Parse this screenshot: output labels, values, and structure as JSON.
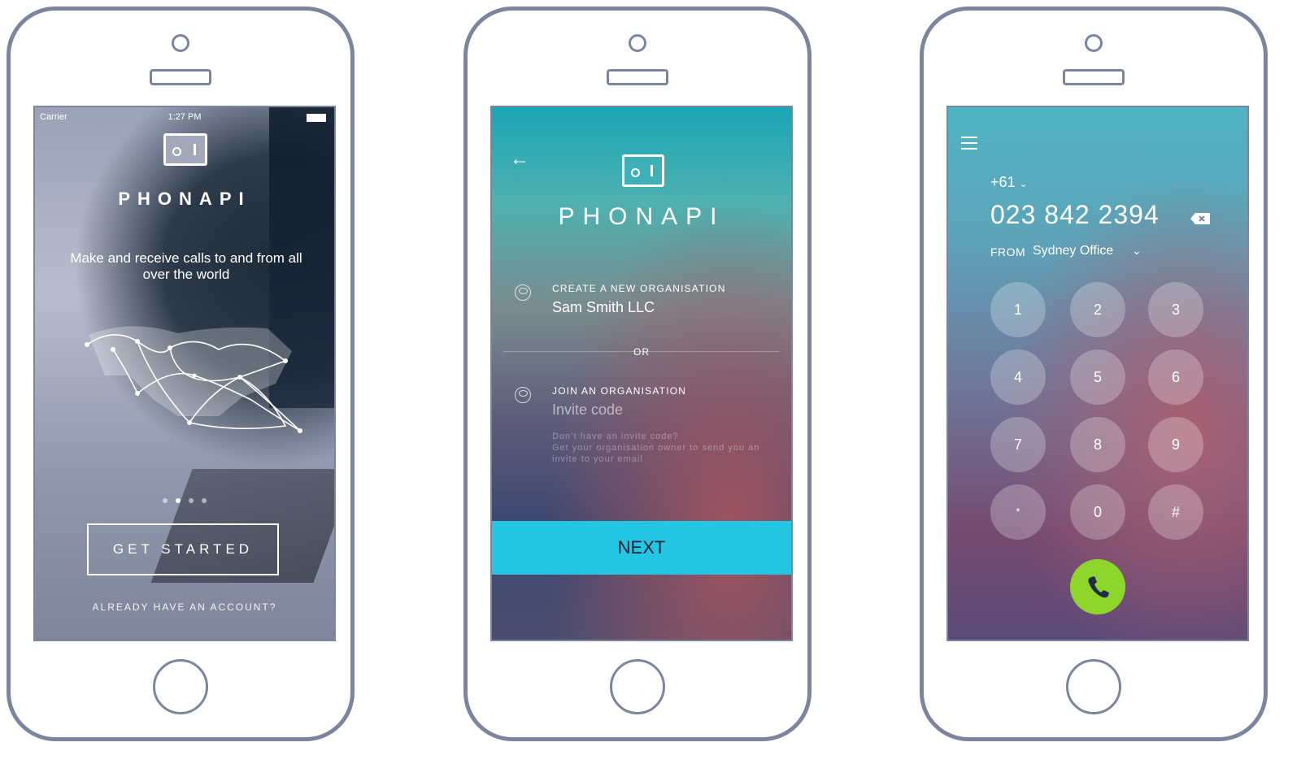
{
  "screen1": {
    "status": {
      "carrier": "Carrier",
      "time": "1:27 PM"
    },
    "brand": "PHONAPI",
    "tagline": "Make and receive calls to and from all over the world",
    "pagination": {
      "count": 4,
      "active": 2
    },
    "get_started": "GET STARTED",
    "already": "ALREADY HAVE AN ACCOUNT?"
  },
  "screen2": {
    "brand": "PHONAPI",
    "create_label": "CREATE A NEW ORGANISATION",
    "create_value": "Sam Smith LLC",
    "or": "OR",
    "join_label": "JOIN AN ORGANISATION",
    "invite_placeholder": "Invite code",
    "hint_line1": "Don’t have an invite code?",
    "hint_line2": "Get your organisation owner to send you an invite to your email",
    "next": "NEXT"
  },
  "screen3": {
    "country_code": "+61",
    "phone_number": "023 842 2394",
    "from_label": "FROM",
    "from_value": "Sydney Office",
    "keys": [
      "1",
      "2",
      "3",
      "4",
      "5",
      "6",
      "7",
      "8",
      "9",
      "*",
      "0",
      "#"
    ],
    "call_color": "#8ed52c"
  },
  "colors": {
    "phone_outline": "#7c859e",
    "next_button": "#25c6e4"
  }
}
